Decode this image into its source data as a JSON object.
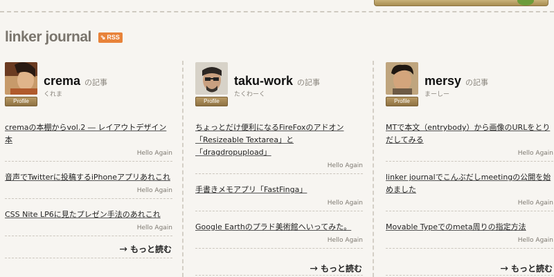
{
  "site": {
    "title": "linker journal",
    "rss_label": "RSS",
    "rss_wave": "⇘"
  },
  "columns": [
    {
      "name": "crema",
      "suffix": "の記事",
      "kana": "くれま",
      "profile_label": "Profile",
      "articles": [
        {
          "title": "cremaの本棚からvol.2 ― レイアウトデザイン本",
          "meta": "Hello Again"
        },
        {
          "title": "音声でTwitterに投稿するiPhoneアプリあれこれ",
          "meta": "Hello Again"
        },
        {
          "title": "CSS Nite LP6に見たプレゼン手法のあれこれ",
          "meta": "Hello Again"
        }
      ],
      "more_label": "もっと読む"
    },
    {
      "name": "taku-work",
      "suffix": "の記事",
      "kana": "たくわーく",
      "profile_label": "Profile",
      "articles": [
        {
          "title": "ちょっとだけ便利になるFireFoxのアドオン「Resizeable Textarea」と「dragdropupload」",
          "meta": "Hello Again"
        },
        {
          "title": "手書きメモアプリ「FastFinga」",
          "meta": "Hello Again"
        },
        {
          "title": "Google Earthのプラド美術館へいってみた。",
          "meta": "Hello Again"
        }
      ],
      "more_label": "もっと読む"
    },
    {
      "name": "mersy",
      "suffix": "の記事",
      "kana": "まーしー",
      "profile_label": "Profile",
      "articles": [
        {
          "title": "MTで本文（entrybody）から画像のURLをとりだしてみる",
          "meta": "Hello Again"
        },
        {
          "title": "linker journalでこんぶだしmeetingの公開を始めました",
          "meta": "Hello Again"
        },
        {
          "title": "Movable Typeでのmeta周りの指定方法",
          "meta": "Hello Again"
        }
      ],
      "more_label": "もっと読む"
    }
  ],
  "more_arrow": "→"
}
